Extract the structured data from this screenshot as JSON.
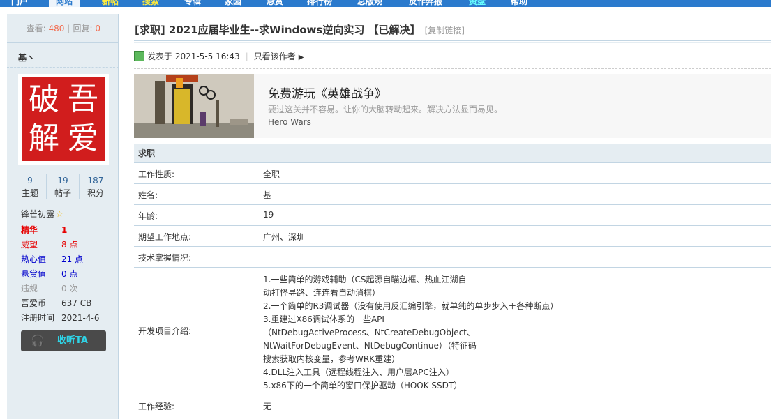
{
  "nav": {
    "items": [
      {
        "label": "门户",
        "state": "normal"
      },
      {
        "label": "网站",
        "state": "active"
      },
      {
        "label": "新帖",
        "state": "hl"
      },
      {
        "label": "搜索",
        "state": "hl"
      },
      {
        "label": "专辑",
        "state": "normal"
      },
      {
        "label": "家园",
        "state": "normal"
      },
      {
        "label": "悬赏",
        "state": "normal"
      },
      {
        "label": "排行榜",
        "state": "normal"
      },
      {
        "label": "总版规",
        "state": "normal"
      },
      {
        "label": "反作弊报",
        "state": "normal"
      },
      {
        "label": "资盘",
        "state": "cyan"
      },
      {
        "label": "帮助",
        "state": "normal"
      }
    ]
  },
  "sidebar": {
    "views_label": "查看:",
    "views": "480",
    "replies_label": "回复:",
    "replies": "0",
    "username": "基丶",
    "avatar_chars": [
      "破",
      "吾",
      "解",
      "爱"
    ],
    "counters": [
      {
        "value": "9",
        "label": "主题"
      },
      {
        "value": "19",
        "label": "帖子"
      },
      {
        "value": "187",
        "label": "积分"
      }
    ],
    "rank": "锋芒初露",
    "props": [
      {
        "key": "精华",
        "value": "1",
        "color": "#e60000",
        "bold": true
      },
      {
        "key": "威望",
        "value": "8 点",
        "color": "#e60000",
        "bold": false
      },
      {
        "key": "热心值",
        "value": "21 点",
        "color": "#0000cc",
        "bold": false
      },
      {
        "key": "悬赏值",
        "value": "0 点",
        "color": "#0000cc",
        "bold": false
      },
      {
        "key": "违规",
        "value": "0 次",
        "color": "#999999",
        "bold": false
      },
      {
        "key": "吾爱币",
        "value": "637 CB",
        "color": "#333333",
        "bold": false
      },
      {
        "key": "注册时间",
        "value": "2021-4-6",
        "color": "#333333",
        "bold": false
      }
    ],
    "listen_button": "收听TA"
  },
  "thread": {
    "title": "[求职] 2021应届毕业生--求Windows逆向实习 【已解决】",
    "copy_link": "[复制链接]",
    "posted": "发表于 2021-5-5 16:43",
    "author_only": "只看该作者"
  },
  "ad": {
    "title": "免费游玩《英雄战争》",
    "desc": "要过这关并不容易。让你的大脑转动起来。解决方法显而易见。",
    "brand": "Hero Wars"
  },
  "job": {
    "header": "求职",
    "rows": [
      {
        "key": "工作性质:",
        "value": "全职"
      },
      {
        "key": "姓名:",
        "value": "基"
      },
      {
        "key": "年龄:",
        "value": "19"
      },
      {
        "key": "期望工作地点:",
        "value": "广州、深圳"
      },
      {
        "key": "技术掌握情况:",
        "value": ""
      },
      {
        "key": "开发项目介绍:",
        "value": "1.一些简单的游戏辅助（CS起源自瞄边框、热血江湖自\n动打怪寻路、连连看自动消棋）\n2.一个简单的R3调试器（没有使用反汇编引擎，就单纯的单步步入＋各种断点）\n3.重建过X86调试体系的一些API\n（NtDebugActiveProcess、NtCreateDebugObject、\nNtWaitForDebugEvent、NtDebugContinue）（特征码\n搜索获取内核变量，参考WRK重建）\n4.DLL注入工具（远程线程注入、用户层APC注入）\n5.x86下的一个简单的窗口保护驱动（HOOK SSDT）"
      },
      {
        "key": "工作经验:",
        "value": "无"
      }
    ]
  }
}
